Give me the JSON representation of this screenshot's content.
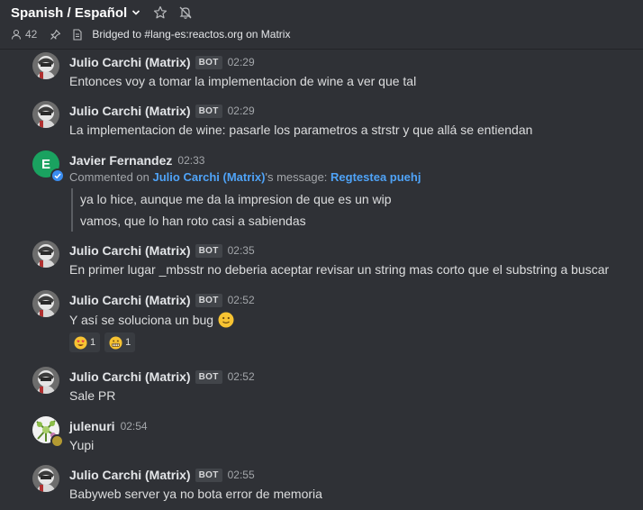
{
  "header": {
    "room_title": "Spanish / Español",
    "member_count": "42",
    "topic": "Bridged to #lang-es:reactos.org on Matrix",
    "icons": [
      "chevron-down-icon",
      "star-icon",
      "bell-off-icon",
      "user-icon",
      "pin-icon",
      "file-icon"
    ]
  },
  "colors": {
    "background": "#2f3136",
    "link": "#4fa3f7",
    "avatar_green": "#1aa260",
    "verified_blue": "#3b8df0",
    "away_yellow": "#b39a32"
  },
  "messages": [
    {
      "sender": "Julio Carchi (Matrix)",
      "badge": "BOT",
      "time": "02:29",
      "text": "Entonces voy a tomar la implementacion de wine a ver que tal"
    },
    {
      "sender": "Julio Carchi (Matrix)",
      "badge": "BOT",
      "time": "02:29",
      "text": "La implementacion de wine: pasarle los parametros a strstr y que allá se entiendan"
    },
    {
      "sender": "Javier Fernandez",
      "avatar_letter": "E",
      "time": "02:33",
      "commented_prefix": "Commented on ",
      "commented_user": "Julio Carchi (Matrix)",
      "commented_mid": "'s message: ",
      "commented_link": "Regtestea puehj",
      "quote": [
        "ya lo hice, aunque me da la impresion de que es un wip",
        "vamos, que lo han roto casi a sabiendas"
      ]
    },
    {
      "sender": "Julio Carchi (Matrix)",
      "badge": "BOT",
      "time": "02:35",
      "text": "En primer lugar _mbsstr no deberia aceptar revisar un string mas corto que el substring a buscar"
    },
    {
      "sender": "Julio Carchi (Matrix)",
      "badge": "BOT",
      "time": "02:52",
      "text": "Y así se soluciona un bug",
      "emoji": "slightly-smiling-face-icon",
      "reactions": [
        {
          "emoji": "heart-eyes-icon",
          "count": "1"
        },
        {
          "emoji": "grimacing-face-icon",
          "count": "1"
        }
      ]
    },
    {
      "sender": "Julio Carchi (Matrix)",
      "badge": "BOT",
      "time": "02:52",
      "text": "Sale PR"
    },
    {
      "sender": "julenuri",
      "time": "02:54",
      "text": "Yupi"
    },
    {
      "sender": "Julio Carchi (Matrix)",
      "badge": "BOT",
      "time": "02:55",
      "text": "Babyweb server ya no bota error de memoria"
    }
  ]
}
